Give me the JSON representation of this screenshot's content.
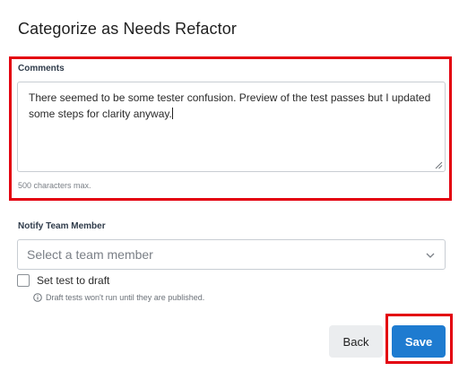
{
  "dialog": {
    "title": "Categorize as Needs Refactor"
  },
  "comments": {
    "label": "Comments",
    "value": "There seemed to be some tester confusion. Preview of the test passes but I updated some steps for clarity anyway.",
    "hint": "500 characters max."
  },
  "notify": {
    "label": "Notify Team Member",
    "placeholder": "Select a team member"
  },
  "draft": {
    "checkbox_label": "Set test to draft",
    "checked": false,
    "hint": "Draft tests won't run until they are published."
  },
  "actions": {
    "back_label": "Back",
    "save_label": "Save"
  },
  "colors": {
    "accent": "#1e7bd0",
    "highlight": "#e3000f"
  }
}
